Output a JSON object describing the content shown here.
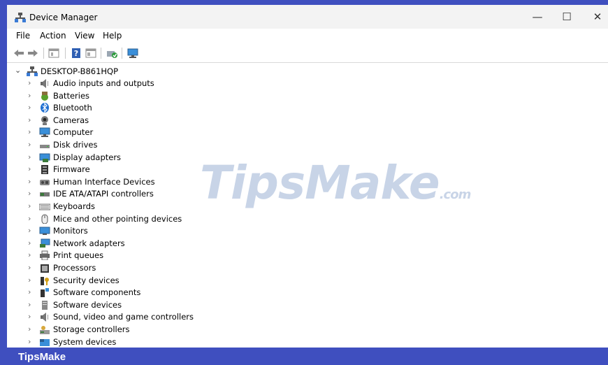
{
  "window": {
    "title": "Device Manager"
  },
  "window_controls": {
    "minimize": "—",
    "maximize": "☐",
    "close": "✕"
  },
  "menu": [
    "File",
    "Action",
    "View",
    "Help"
  ],
  "toolbar": {
    "icons": [
      "back-arrow-icon",
      "forward-arrow-icon",
      "properties-icon",
      "help-icon",
      "show-hidden-icon",
      "update-driver-icon",
      "monitor-scan-icon"
    ]
  },
  "tree": {
    "root": {
      "label": "DESKTOP-B861HQP",
      "expanded": true
    },
    "categories": [
      {
        "label": "Audio inputs and outputs",
        "icon": "speaker-icon"
      },
      {
        "label": "Batteries",
        "icon": "battery-icon"
      },
      {
        "label": "Bluetooth",
        "icon": "bluetooth-icon"
      },
      {
        "label": "Cameras",
        "icon": "camera-icon"
      },
      {
        "label": "Computer",
        "icon": "computer-icon"
      },
      {
        "label": "Disk drives",
        "icon": "disk-drive-icon"
      },
      {
        "label": "Display adapters",
        "icon": "display-adapter-icon"
      },
      {
        "label": "Firmware",
        "icon": "firmware-icon"
      },
      {
        "label": "Human Interface Devices",
        "icon": "hid-icon"
      },
      {
        "label": "IDE ATA/ATAPI controllers",
        "icon": "ide-controller-icon"
      },
      {
        "label": "Keyboards",
        "icon": "keyboard-icon"
      },
      {
        "label": "Mice and other pointing devices",
        "icon": "mouse-icon"
      },
      {
        "label": "Monitors",
        "icon": "monitor-icon"
      },
      {
        "label": "Network adapters",
        "icon": "network-adapter-icon"
      },
      {
        "label": "Print queues",
        "icon": "printer-icon"
      },
      {
        "label": "Processors",
        "icon": "processor-icon"
      },
      {
        "label": "Security devices",
        "icon": "security-device-icon"
      },
      {
        "label": "Software components",
        "icon": "software-component-icon"
      },
      {
        "label": "Software devices",
        "icon": "software-device-icon"
      },
      {
        "label": "Sound, video and game controllers",
        "icon": "sound-controller-icon"
      },
      {
        "label": "Storage controllers",
        "icon": "storage-controller-icon"
      },
      {
        "label": "System devices",
        "icon": "system-devices-icon"
      }
    ]
  },
  "watermark": {
    "main": "TipsMake",
    "suffix": ".com"
  },
  "footer": {
    "brand": "TipsMake"
  },
  "colors": {
    "frame": "#3f4fbf",
    "titlebar": "#f3f3f3",
    "watermark": "#3a64aa"
  }
}
